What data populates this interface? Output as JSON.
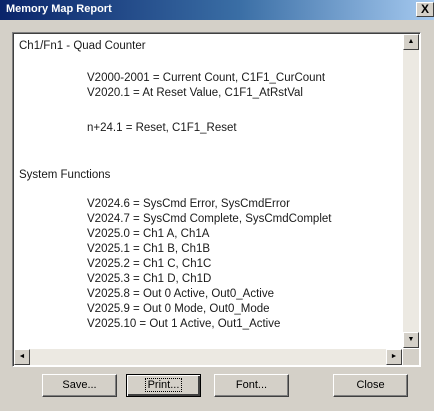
{
  "window": {
    "title": "Memory Map Report",
    "close_label": "X"
  },
  "report": {
    "lines": [
      "Ch1/Fn1 - Quad Counter",
      "V2000-2001 = Current Count, C1F1_CurCount",
      "V2020.1 = At Reset Value, C1F1_AtRstVal",
      "n+24.1 = Reset, C1F1_Reset",
      "System Functions",
      "V2024.6 = SysCmd Error, SysCmdError",
      "V2024.7 = SysCmd Complete, SysCmdComplet",
      "V2025.0 = Ch1 A, Ch1A",
      "V2025.1 = Ch1 B, Ch1B",
      "V2025.2 = Ch1 C, Ch1C",
      "V2025.3 = Ch1 D, Ch1D",
      "V2025.8 = Out 0 Active, Out0_Active",
      "V2025.9 = Out 0 Mode, Out0_Mode",
      "V2025.10 = Out 1 Active, Out1_Active"
    ]
  },
  "scrollbar": {
    "up_icon": "▲",
    "down_icon": "▼",
    "left_icon": "◄",
    "right_icon": "►"
  },
  "buttons": {
    "save": "Save...",
    "print": "Print...",
    "font": "Font...",
    "close": "Close"
  },
  "colors": {
    "titlebar_start": "#0a246a",
    "titlebar_end": "#a6caf0",
    "dialog_bg": "#d4d0c8"
  }
}
